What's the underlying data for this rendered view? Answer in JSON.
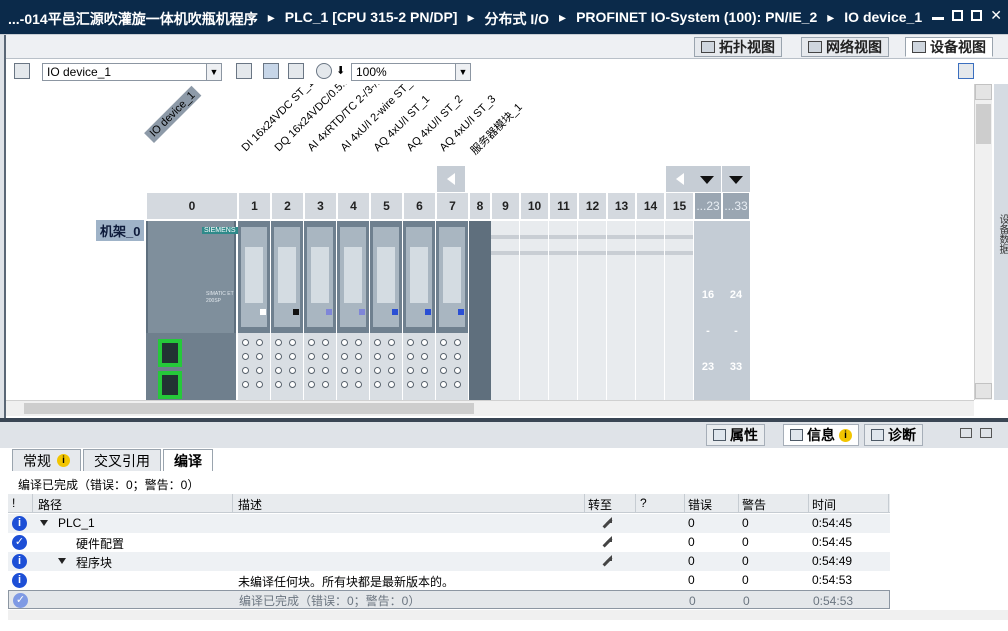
{
  "titlebar": {
    "crumbs": [
      "...-014平邑汇源吹灌旋一体机吹瓶机程序",
      "PLC_1 [CPU 315-2 PN/DP]",
      "分布式 I/O",
      "PROFINET IO-System (100): PN/IE_2",
      "IO device_1"
    ],
    "separator": "▸"
  },
  "viewtabs": {
    "topology": "拓扑视图",
    "network": "网络视图",
    "device": "设备视图"
  },
  "toolbar": {
    "device_select": "IO device_1",
    "zoom": "100%"
  },
  "canvas": {
    "device_tag": "IO device_1",
    "module_labels": [
      "DI 16x24VDC ST_1",
      "DQ 16x24VDC/0.5...",
      "AI 4xRTD/TC 2-/3-/...",
      "AI 4xU/I 2-wire ST_1",
      "AQ 4xU/I ST_1",
      "AQ 4xU/I ST_2",
      "AQ 4xU/I ST_3",
      "服务器模块_1"
    ],
    "slots": [
      "0",
      "1",
      "2",
      "3",
      "4",
      "5",
      "6",
      "7",
      "8",
      "9",
      "10",
      "11",
      "12",
      "13",
      "14",
      "15"
    ],
    "expand_slots": [
      "...23",
      "...33"
    ],
    "expand_ranges": [
      {
        "from": "16",
        "dash": "-",
        "to": "23"
      },
      {
        "from": "24",
        "dash": "-",
        "to": "33"
      }
    ],
    "rack_label": "机架_0",
    "head_module_brand": "SIEMENS",
    "head_module_model": "SIMATIC ET 200SP",
    "sidepanel_label": "设备数据"
  },
  "inspector": {
    "tabs": {
      "properties": "属性",
      "info": "信息",
      "info_badge": "i",
      "diagnostics": "诊断"
    },
    "subtabs": [
      {
        "label": "常规",
        "badge": "i"
      },
      {
        "label": "交叉引用"
      },
      {
        "label": "编译"
      }
    ],
    "status": "编译已完成（错误：0；警告：0）",
    "columns": {
      "flag": "!",
      "path": "路径",
      "description": "描述",
      "goto": "转至",
      "q": "?",
      "errors": "错误",
      "warnings": "警告",
      "time": "时间"
    },
    "rows": [
      {
        "icon": "info",
        "indent": 0,
        "expand": true,
        "path": "PLC_1",
        "description": "",
        "goto": true,
        "errors": "0",
        "warnings": "0",
        "time": "0:54:45"
      },
      {
        "icon": "check",
        "indent": 2,
        "expand": false,
        "path": "硬件配置",
        "description": "",
        "goto": true,
        "errors": "0",
        "warnings": "0",
        "time": "0:54:45"
      },
      {
        "icon": "info",
        "indent": 1,
        "expand": true,
        "path": "程序块",
        "description": "",
        "goto": true,
        "errors": "0",
        "warnings": "0",
        "time": "0:54:49"
      },
      {
        "icon": "info",
        "indent": 0,
        "expand": false,
        "path": "",
        "description": "未编译任何块。所有块都是最新版本的。",
        "goto": false,
        "errors": "0",
        "warnings": "0",
        "time": "0:54:53"
      },
      {
        "icon": "check",
        "indent": 0,
        "expand": false,
        "path": "",
        "description": "编译已完成（错误：0；警告：0）",
        "goto": false,
        "errors": "0",
        "warnings": "0",
        "time": "0:54:53"
      }
    ]
  },
  "colors": {
    "title_bg": "#0b2a4a",
    "port_green": "#25c93a",
    "info_blue": "#1d4fd6",
    "badge_yellow": "#f2c500"
  }
}
